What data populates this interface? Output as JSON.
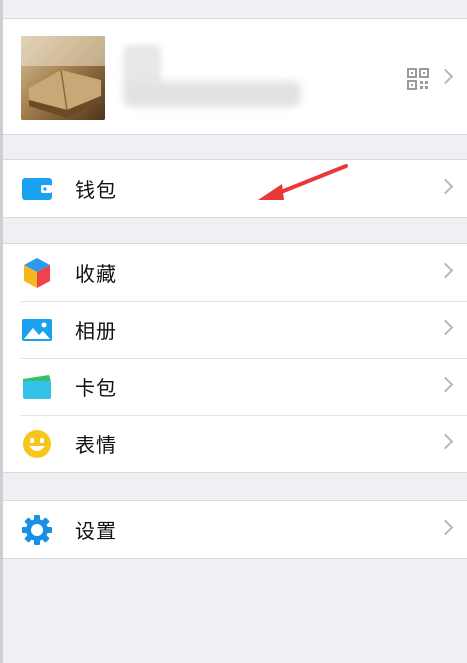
{
  "colors": {
    "page_bg": "#efeff4",
    "wallet_icon": "#1aa1f0",
    "album_icon": "#1aa1f0",
    "card_icon": "#34c1e9",
    "emoji_icon": "#f7c61c",
    "settings_icon": "#1a8fe6",
    "arrow_annotation": "#e8393a"
  },
  "profile": {
    "qr_icon": "qr-code-icon",
    "chevron_icon": "chevron-right-icon"
  },
  "wallet_group": {
    "items": [
      {
        "label": "钱包",
        "icon": "wallet-icon"
      }
    ]
  },
  "main_group": {
    "items": [
      {
        "label": "收藏",
        "icon": "favorites-cube-icon"
      },
      {
        "label": "相册",
        "icon": "album-picture-icon"
      },
      {
        "label": "卡包",
        "icon": "card-wallet-icon"
      },
      {
        "label": "表情",
        "icon": "emoji-smile-icon"
      }
    ]
  },
  "settings_group": {
    "items": [
      {
        "label": "设置",
        "icon": "settings-gear-icon"
      }
    ]
  }
}
